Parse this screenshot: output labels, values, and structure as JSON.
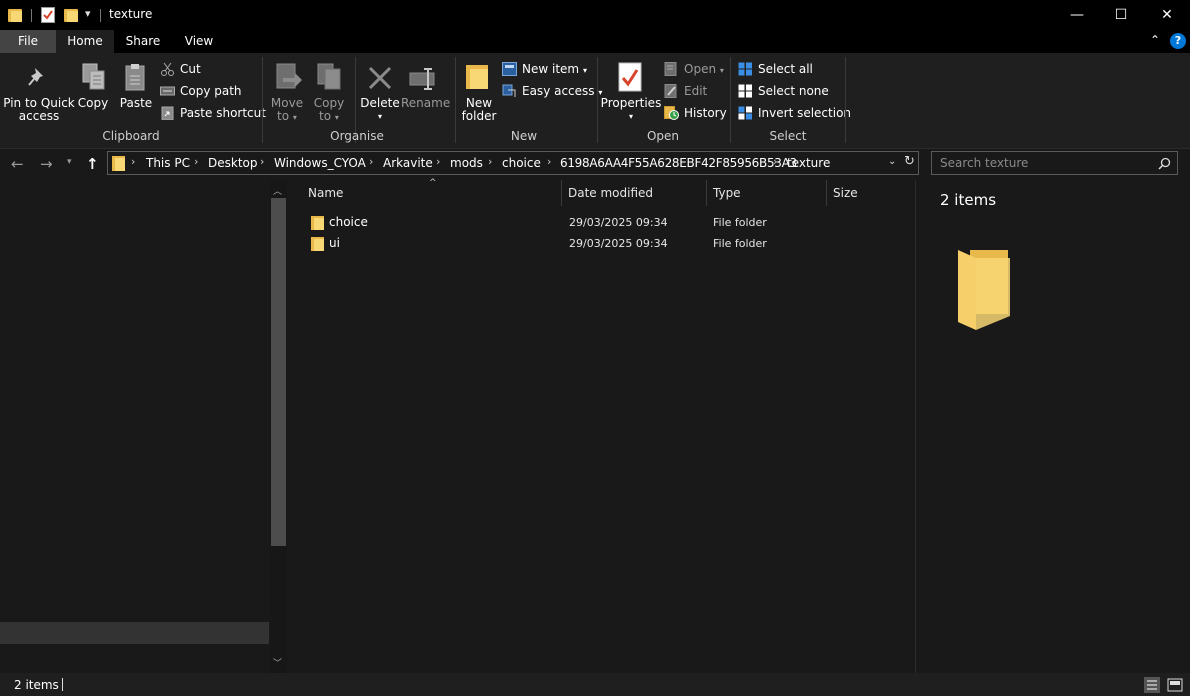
{
  "window": {
    "title": "texture",
    "minimize_glyph": "—",
    "maximize_glyph": "☐",
    "close_glyph": "✕"
  },
  "tabs": [
    "File",
    "Home",
    "Share",
    "View"
  ],
  "ribbon": {
    "clipboard": {
      "label": "Clipboard",
      "pin_line1": "Pin to Quick",
      "pin_line2": "access",
      "copy": "Copy",
      "paste": "Paste",
      "cut": "Cut",
      "copy_path": "Copy path",
      "paste_shortcut": "Paste shortcut"
    },
    "organise": {
      "label": "Organise",
      "move_line1": "Move",
      "move_line2": "to",
      "copy_line1": "Copy",
      "copy_line2": "to",
      "delete": "Delete",
      "rename": "Rename"
    },
    "new": {
      "label": "New",
      "folder_line1": "New",
      "folder_line2": "folder",
      "new_item": "New item",
      "easy_access": "Easy access"
    },
    "open": {
      "label": "Open",
      "properties": "Properties",
      "open": "Open",
      "edit": "Edit",
      "history": "History"
    },
    "select": {
      "label": "Select",
      "select_all": "Select all",
      "select_none": "Select none",
      "invert": "Invert selection"
    }
  },
  "address": {
    "crumbs": [
      "This PC",
      "Desktop",
      "Windows_CYOA",
      "Arkavite",
      "mods",
      "choice",
      "6198A6AA4F55A628EBF42F85956B53A3",
      "texture"
    ],
    "search_placeholder": "Search texture"
  },
  "columns": {
    "name": "Name",
    "date": "Date modified",
    "type": "Type",
    "size": "Size"
  },
  "files": [
    {
      "name": "choice",
      "date": "29/03/2025 09:34",
      "type": "File folder"
    },
    {
      "name": "ui",
      "date": "29/03/2025 09:34",
      "type": "File folder"
    }
  ],
  "preview": {
    "count": "2 items"
  },
  "status": {
    "text": "2 items"
  },
  "colors": {
    "folder": "#f8d775",
    "folder_back": "#e8b84a",
    "accent": "#0078d7"
  }
}
